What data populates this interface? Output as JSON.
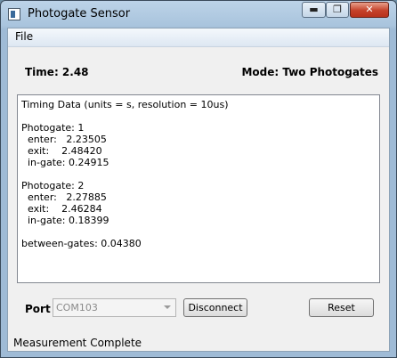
{
  "window": {
    "title": "Photogate Sensor",
    "min": "▬",
    "max": "❐",
    "close": "✕"
  },
  "menu": {
    "file": "File"
  },
  "header": {
    "time": "Time: 2.48",
    "mode": "Mode: Two Photogates"
  },
  "timing_data": {
    "lines": [
      "Timing Data (units = s, resolution = 10us)",
      "",
      "Photogate: 1",
      "  enter:   2.23505",
      "  exit:    2.48420",
      "  in-gate: 0.24915",
      "",
      "Photogate: 2",
      "  enter:   2.27885",
      "  exit:    2.46284",
      "  in-gate: 0.18399",
      "",
      "between-gates: 0.04380"
    ]
  },
  "controls": {
    "port_label": "Port",
    "port_value": "COM103",
    "disconnect": "Disconnect",
    "reset": "Reset"
  },
  "status": "Measurement Complete"
}
